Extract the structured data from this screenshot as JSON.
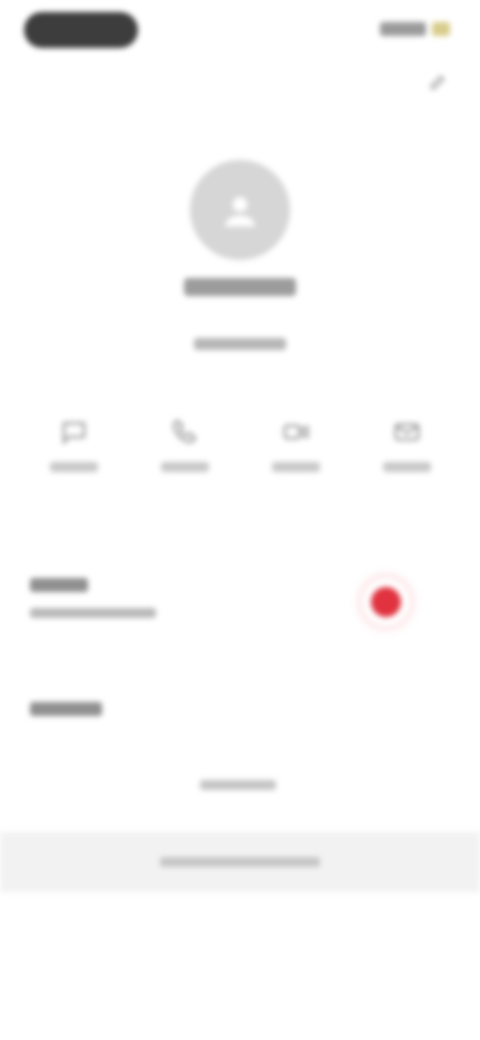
{
  "status_bar": {
    "time": ""
  },
  "icons": {
    "top_right": "edit-icon",
    "avatar": "person-icon",
    "actions": [
      "message-icon",
      "call-icon",
      "video-icon",
      "mail-icon"
    ]
  },
  "contact": {
    "name": "",
    "subtitle": ""
  },
  "actions": [
    {
      "label": ""
    },
    {
      "label": ""
    },
    {
      "label": ""
    },
    {
      "label": ""
    }
  ],
  "rows": [
    {
      "title": "",
      "value": ""
    },
    {
      "title": ""
    }
  ],
  "link": {
    "label": ""
  },
  "bottom_bar": {
    "label": ""
  },
  "colors": {
    "accent": "#e0323f",
    "status_pill": "#3d3d3d",
    "avatar_bg": "#d6d6d6",
    "bottom_bar_bg": "#f2f2f2"
  }
}
